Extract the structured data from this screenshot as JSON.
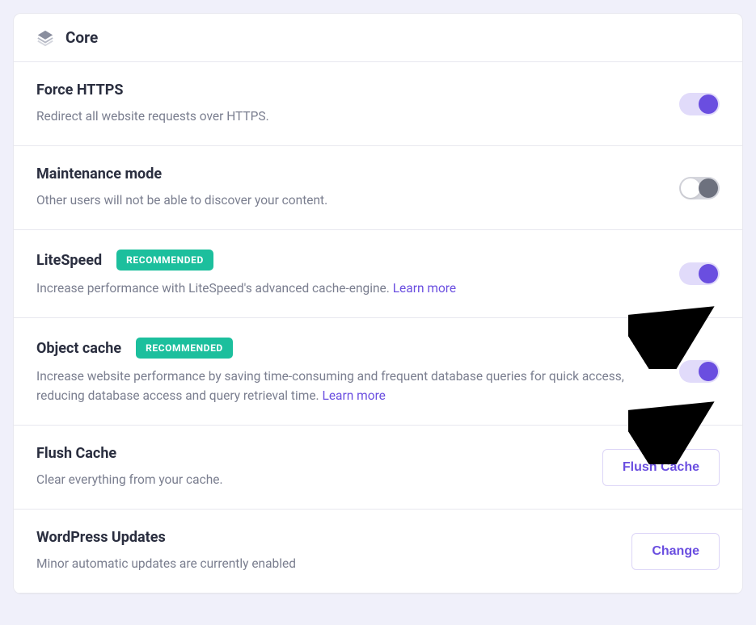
{
  "panel": {
    "title": "Core"
  },
  "rows": {
    "forceHttps": {
      "title": "Force HTTPS",
      "desc": "Redirect all website requests over HTTPS.",
      "toggle": "on"
    },
    "maintenance": {
      "title": "Maintenance mode",
      "desc": "Other users will not be able to discover your content.",
      "toggle": "off"
    },
    "litespeed": {
      "title": "LiteSpeed",
      "badge": "RECOMMENDED",
      "desc": "Increase performance with LiteSpeed's advanced cache-engine. ",
      "learnMore": "Learn more",
      "toggle": "on"
    },
    "objectCache": {
      "title": "Object cache",
      "badge": "RECOMMENDED",
      "desc": "Increase website performance by saving time-consuming and frequent database queries for quick access, reducing database access and query retrieval time. ",
      "learnMore": "Learn more",
      "toggle": "on"
    },
    "flushCache": {
      "title": "Flush Cache",
      "desc": "Clear everything from your cache.",
      "button": "Flush Cache"
    },
    "wpUpdates": {
      "title": "WordPress Updates",
      "desc": "Minor automatic updates are currently enabled",
      "button": "Change"
    }
  }
}
